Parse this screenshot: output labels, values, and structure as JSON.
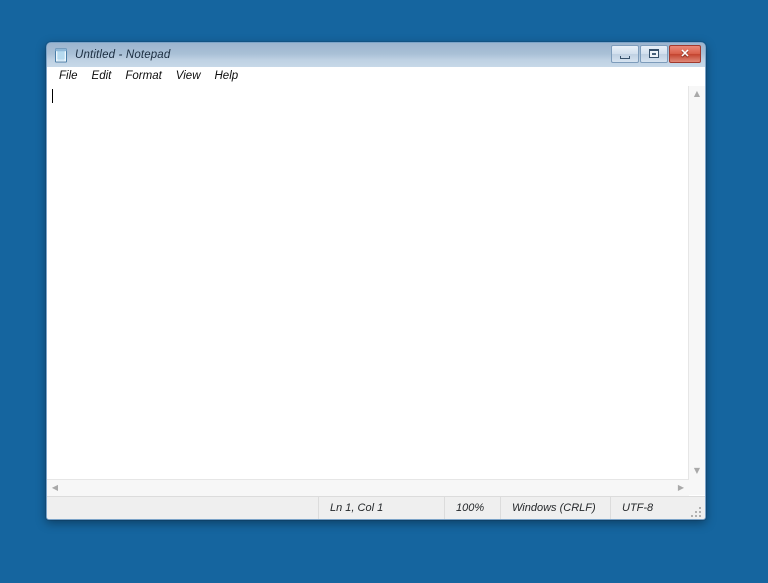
{
  "desktop": {
    "background_color": "#15659F"
  },
  "window": {
    "title": "Untitled - Notepad",
    "icon": "notepad-icon",
    "controls": {
      "minimize_label": "–",
      "maximize_label": "□",
      "close_label": "✕"
    },
    "menubar": [
      {
        "label": "File"
      },
      {
        "label": "Edit"
      },
      {
        "label": "Format"
      },
      {
        "label": "View"
      },
      {
        "label": "Help"
      }
    ],
    "document": {
      "content": "",
      "caret_visible": true
    },
    "scrollbars": {
      "vertical_up": "▲",
      "vertical_down": "▼",
      "horizontal_left": "◀",
      "horizontal_right": "▶"
    },
    "statusbar": {
      "empty": "",
      "line_col": "Ln 1, Col 1",
      "zoom": "100%",
      "line_ending": "Windows (CRLF)",
      "encoding": "UTF-8"
    }
  }
}
